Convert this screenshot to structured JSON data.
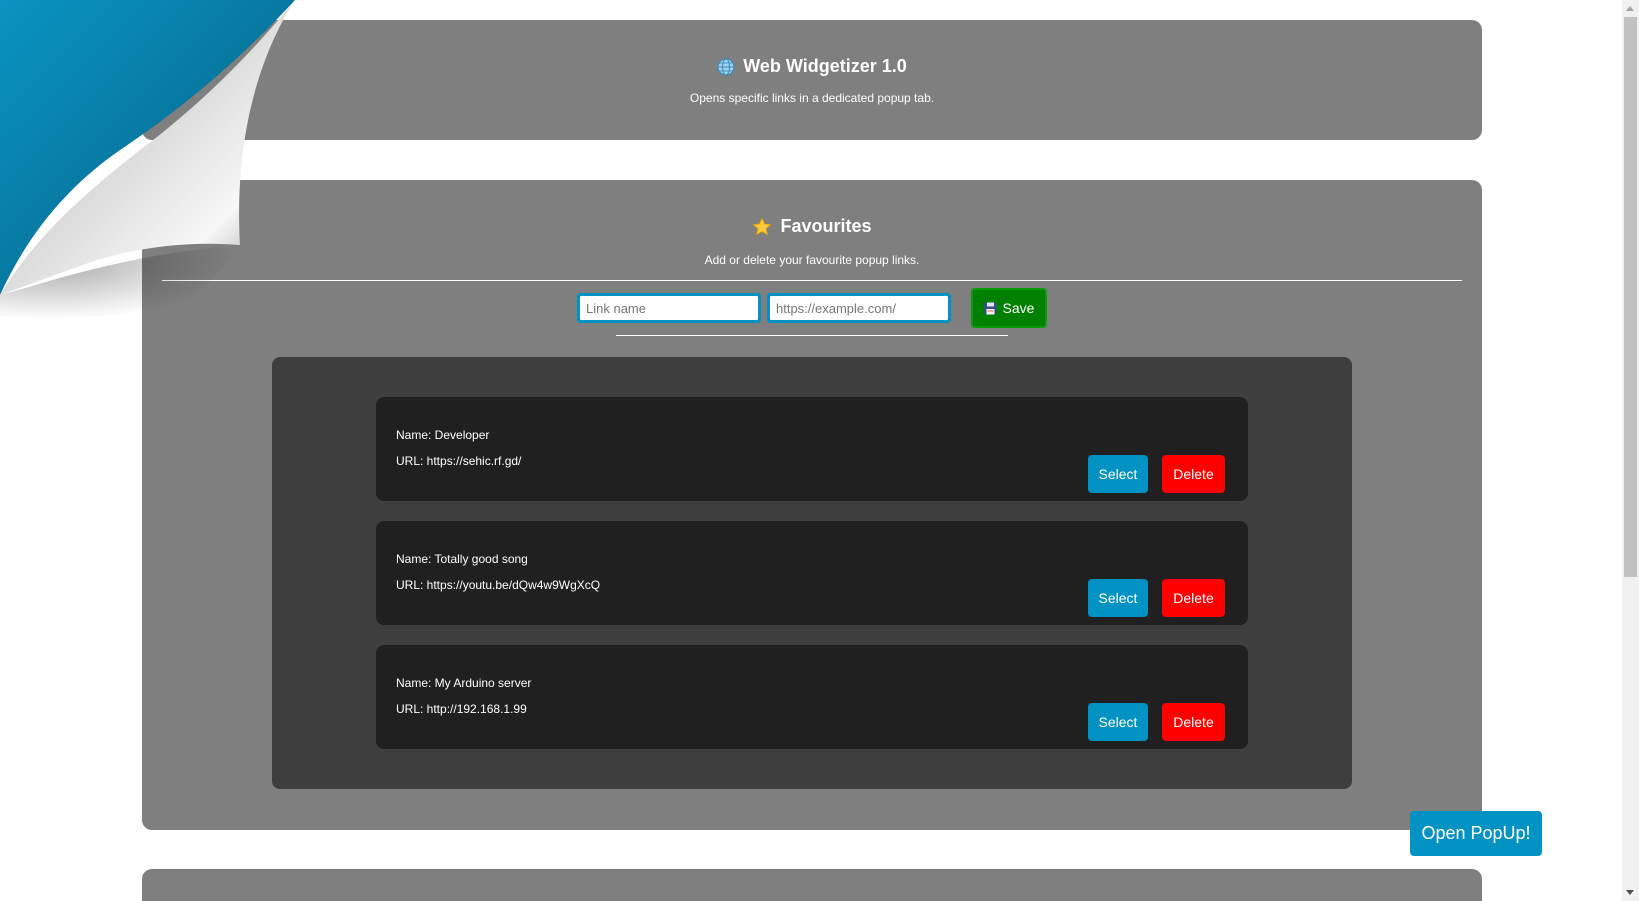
{
  "header": {
    "icon": "globe-icon",
    "title": "Web Widgetizer 1.0",
    "subtitle": "Opens specific links in a dedicated popup tab."
  },
  "favourites": {
    "icon": "star-icon",
    "title": "Favourites",
    "subtitle": "Add or delete your favourite popup links.",
    "name_placeholder": "Link name",
    "url_placeholder": "https://example.com/",
    "save_icon": "floppy-disk-icon",
    "save_label": "Save",
    "items": [
      {
        "name": "Name: Developer",
        "url": "URL: https://sehic.rf.gd/",
        "select_label": "Select",
        "delete_label": "Delete"
      },
      {
        "name": "Name: Totally good song",
        "url": "URL: https://youtu.be/dQw4w9WgXcQ",
        "select_label": "Select",
        "delete_label": "Delete"
      },
      {
        "name": "Name: My Arduino server",
        "url": "URL: http://192.168.1.99",
        "select_label": "Select",
        "delete_label": "Delete"
      }
    ]
  },
  "popup_button_label": "Open PopUp!",
  "colors": {
    "panel": "#7f7f7f",
    "list_background": "#3e3e3e",
    "item_background": "#202020",
    "accent_blue": "#0292c4",
    "save_green": "#008000",
    "delete_red": "#ff0000",
    "page_curl": "#0585b0"
  }
}
